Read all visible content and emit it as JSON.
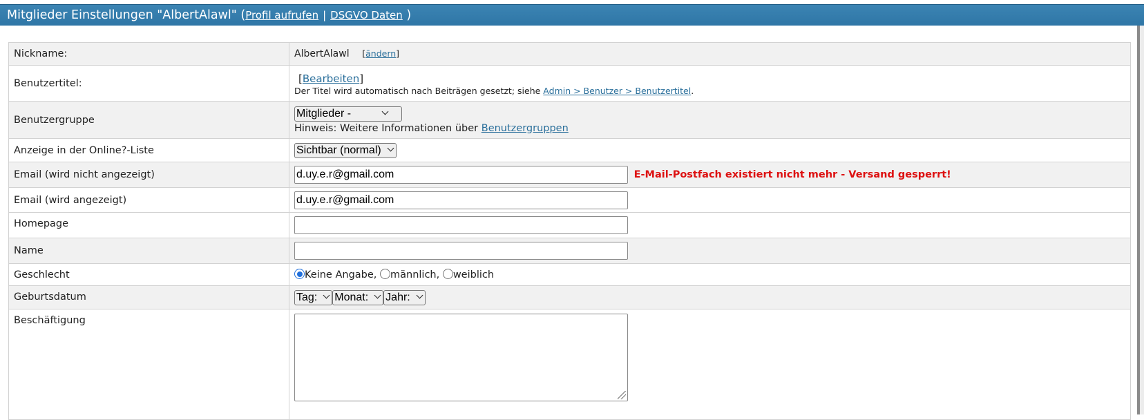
{
  "header": {
    "title": "Mitglieder Einstellungen \"AlbertAlawl\" (",
    "profile_link": "Profil aufrufen",
    "separator": "|",
    "dsgvo_link": "DSGVO Daten",
    "close_paren": ")"
  },
  "rows": {
    "nickname": {
      "label": "Nickname:",
      "value": "AlbertAlawl",
      "change_open": "[",
      "change_link": "ändern",
      "change_close": "]"
    },
    "title": {
      "label": "Benutzertitel:",
      "edit_open": "[",
      "edit_link": "Bearbeiten",
      "edit_close": "]",
      "hint": "Der Titel wird automatisch nach Beiträgen gesetzt; siehe",
      "hint_link": "Admin > Benutzer > Benutzertitel",
      "hint_end": "."
    },
    "group": {
      "label": "Benutzergruppe",
      "selected": "Mitglieder -",
      "hint": "Hinweis: Weitere Informationen über",
      "hint_link": "Benutzergruppen"
    },
    "online": {
      "label": "Anzeige in der Online?-Liste",
      "selected": "Sichtbar (normal)"
    },
    "email_hidden": {
      "label": "Email (wird nicht angezeigt)",
      "value": "d.uy.e.r@gmail.com",
      "warning": "E-Mail-Postfach existiert nicht mehr - Versand gesperrt!",
      "warning_color": "#dd1111"
    },
    "email_shown": {
      "label": "Email (wird angezeigt)",
      "value": "d.uy.e.r@gmail.com"
    },
    "homepage": {
      "label": "Homepage",
      "value": ""
    },
    "name": {
      "label": "Name",
      "value": ""
    },
    "gender": {
      "label": "Geschlecht",
      "options": [
        "Keine Angabe,",
        "männlich,",
        "weiblich"
      ],
      "selected_index": 0
    },
    "birthday": {
      "label": "Geburtsdatum",
      "day": "Tag:",
      "month": "Monat:",
      "year": "Jahr:"
    },
    "job": {
      "label": "Beschäftigung",
      "value": ""
    }
  },
  "colors": {
    "header": "#2f76a6",
    "link": "#2a6f9b",
    "row_alt": "#f1f1f1"
  }
}
